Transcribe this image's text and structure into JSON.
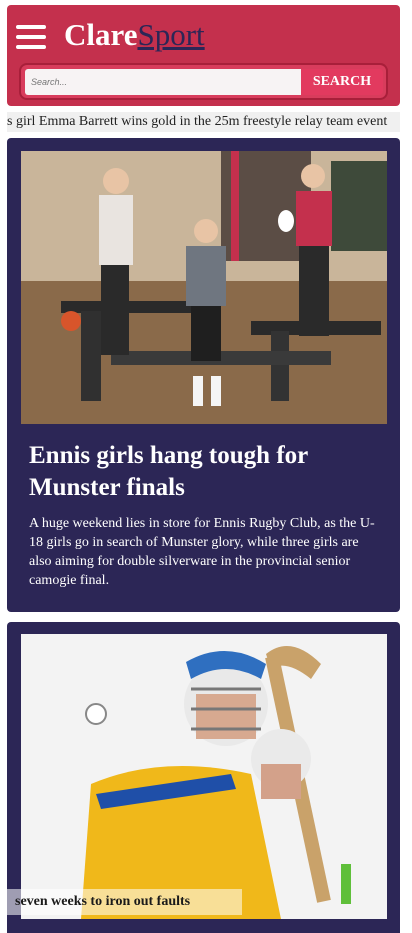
{
  "header": {
    "logo_part1": "Clare",
    "logo_part2": "Sport",
    "search_placeholder": "Search...",
    "search_button": "SEARCH"
  },
  "ticker": {
    "text": "s girl Emma Barrett wins gold in the 25m freestyle relay team event"
  },
  "articles": [
    {
      "headline": "Ennis girls hang tough for Munster finals",
      "summary": "A huge weekend lies in store for Ennis Rugby Club, as the U-18 girls go in search of Munster glory, while three girls are also aiming for double silverware in the provincial senior camogie final."
    },
    {
      "caption": "seven weeks to iron out faults"
    }
  ],
  "colors": {
    "header_bg": "#c4304d",
    "card_bg": "#2c2656",
    "accent": "#e23a5f"
  }
}
